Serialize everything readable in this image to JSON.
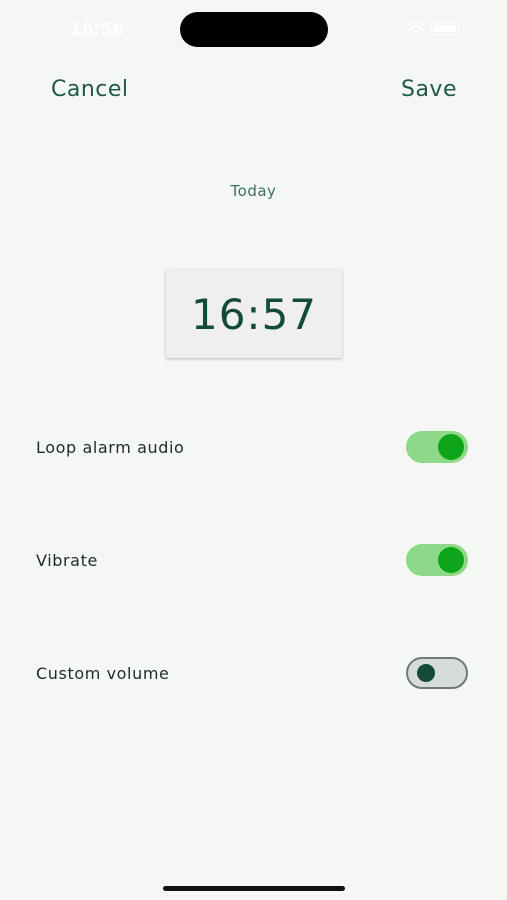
{
  "status_bar": {
    "time": "16:56"
  },
  "header": {
    "cancel_label": "Cancel",
    "save_label": "Save"
  },
  "alarm": {
    "day": "Today",
    "time": "16:57"
  },
  "settings": [
    {
      "label": "Loop alarm audio",
      "enabled": true
    },
    {
      "label": "Vibrate",
      "enabled": true
    },
    {
      "label": "Custom volume",
      "enabled": false
    }
  ],
  "colors": {
    "accent": "#1e5a45",
    "toggle_on_track": "#8ed88a",
    "toggle_on_knob": "#0ea51a",
    "toggle_off_track": "#d6ddd8",
    "toggle_off_knob": "#134a3a",
    "background": "#f5f7f4"
  }
}
